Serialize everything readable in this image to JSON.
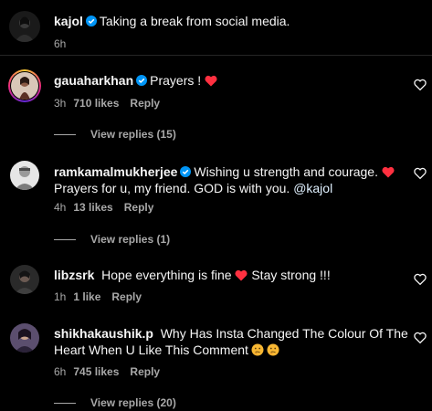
{
  "post": {
    "username": "kajol",
    "caption": "Taking a break from social media.",
    "time": "6h"
  },
  "comments": [
    {
      "username": "gauaharkhan",
      "verified": true,
      "text": "Prayers ! ",
      "time": "3h",
      "likes": "710 likes",
      "reply": "Reply",
      "view_replies": "View replies (15)"
    },
    {
      "username": "ramkamalmukherjee",
      "verified": true,
      "text_line1": "Wishing u strength and courage. ",
      "text_line2": "Prayers for u, my friend. GOD is with you. ",
      "mention": "@kajol",
      "time": "4h",
      "likes": "13 likes",
      "reply": "Reply",
      "view_replies": "View replies (1)"
    },
    {
      "username": "libzsrk",
      "verified": false,
      "text_before": "Hope everything is fine ",
      "text_after": " Stay strong !!!",
      "time": "1h",
      "likes": "1 like",
      "reply": "Reply"
    },
    {
      "username": "shikhakaushik.p",
      "verified": false,
      "text_line1": "Why Has Insta Changed The Colour Of The",
      "text_line2": "Heart When U Like This Comment",
      "time": "6h",
      "likes": "745 likes",
      "reply": "Reply",
      "view_replies": "View replies (20)"
    }
  ],
  "colors": {
    "background": "#000000",
    "text": "#f5f5f5",
    "secondary": "#a8a8a8",
    "verified": "#0095f6",
    "heart": "#ff3040",
    "mention": "#e0f1ff"
  },
  "icons": {
    "verified": "verified-badge-icon",
    "heart_red": "red-heart-emoji-icon",
    "like": "heart-outline-icon",
    "thinking": "thinking-face-emoji-icon"
  }
}
